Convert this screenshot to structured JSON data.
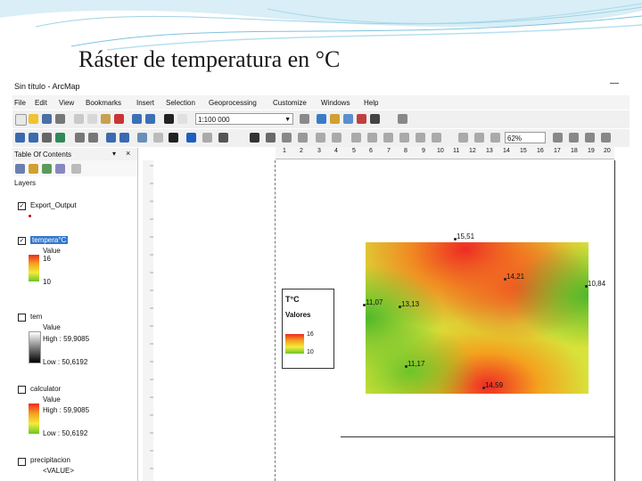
{
  "slide": {
    "title": "Ráster de temperatura en °C"
  },
  "window": {
    "title": "Sin título - ArcMap",
    "minimize_glyph": "—"
  },
  "menu": [
    "File",
    "Edit",
    "View",
    "Bookmarks",
    "Insert",
    "Selection",
    "Geoprocessing",
    "Customize",
    "Windows",
    "Help"
  ],
  "toolbar": {
    "scale_value": "1:100 000",
    "zoom_value": "62%"
  },
  "toc": {
    "title": "Table Of Contents",
    "group_label": "Layers",
    "layers": [
      {
        "name": "Export_Output",
        "checked": true
      },
      {
        "name": "tempera°C",
        "checked": true,
        "value_label": "Value",
        "high": "16",
        "low": "10"
      },
      {
        "name": "tem",
        "checked": false,
        "value_label": "Value",
        "high": "High : 59,9085",
        "low": "Low : 50,6192"
      },
      {
        "name": "calculator",
        "checked": false,
        "value_label": "Value",
        "high": "High : 59,9085",
        "low": "Low : 50,6192"
      },
      {
        "name": "precipitacion",
        "checked": false,
        "value_label": "<VALUE>"
      }
    ]
  },
  "ruler": {
    "h_ticks": [
      "1",
      "2",
      "3",
      "4",
      "5",
      "6",
      "7",
      "8",
      "9",
      "10",
      "11",
      "12",
      "13",
      "14",
      "15",
      "16",
      "17",
      "18",
      "19",
      "20"
    ]
  },
  "map": {
    "points": [
      {
        "label": "15,51"
      },
      {
        "label": "14,21"
      },
      {
        "label": "10,84"
      },
      {
        "label": "11,07"
      },
      {
        "label": "13,13"
      },
      {
        "label": "11,17"
      },
      {
        "label": "14,59"
      }
    ],
    "legend": {
      "title": "T°C",
      "subtitle": "Valores",
      "high": "16",
      "low": "10"
    }
  },
  "colors": {
    "hot": "#ee2a24",
    "warm": "#f4a21e",
    "mid": "#f2ec3a",
    "cool": "#6cc52a"
  }
}
